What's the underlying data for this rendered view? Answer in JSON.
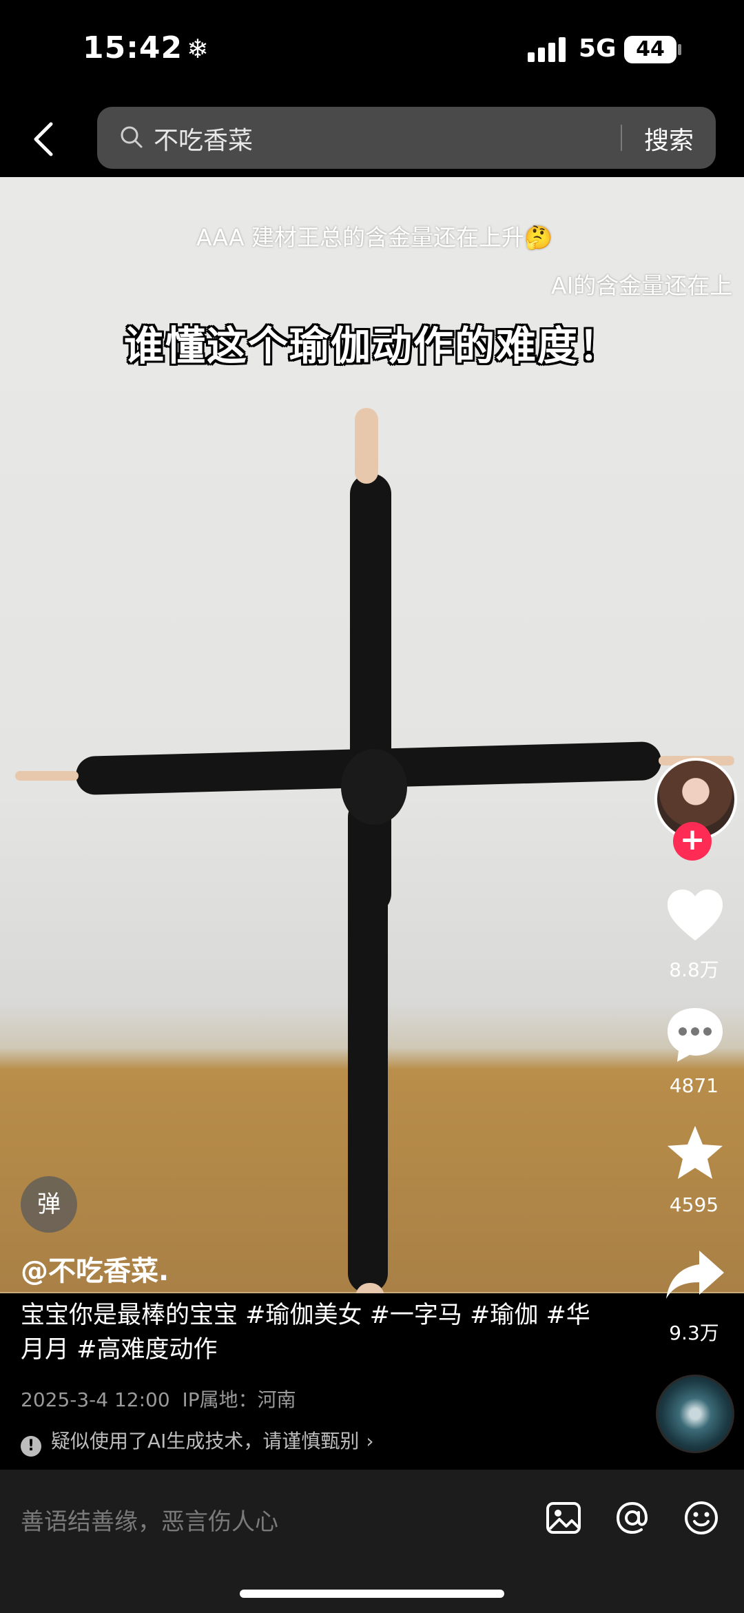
{
  "status_bar": {
    "time": "15:42",
    "network": "5G",
    "battery": "44"
  },
  "search": {
    "query": "不吃香菜",
    "button": "搜索"
  },
  "danmaku": [
    "AAA 建材王总的含金量还在上升🤔",
    "AI的含金量还在上"
  ],
  "video": {
    "caption": "谁懂这个瑜伽动作的难度！",
    "danmaku_toggle": "弹"
  },
  "actions": {
    "likes": "8.8万",
    "comments": "4871",
    "favorites": "4595",
    "shares": "9.3万"
  },
  "post": {
    "author": "@不吃香菜.",
    "description": "宝宝你是最棒的宝宝 #瑜伽美女 #一字马 #瑜伽 #华月月 #高难度动作",
    "date": "2025-3-4 12:00",
    "ip_location": "IP属地：河南",
    "ai_notice": "疑似使用了AI生成技术，请谨慎甄别"
  },
  "comment_bar": {
    "placeholder": "善语结善缘，恶言伤人心"
  }
}
